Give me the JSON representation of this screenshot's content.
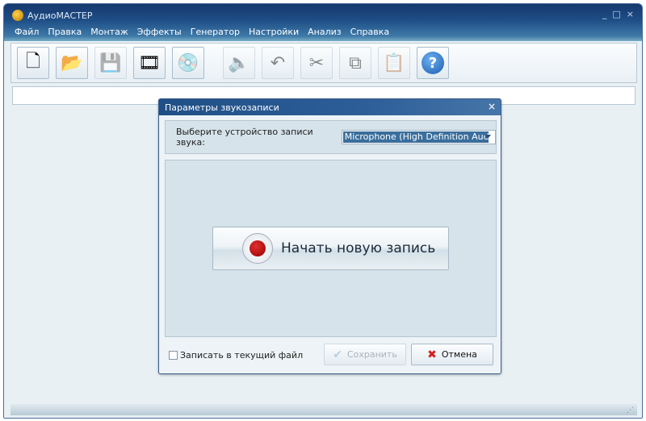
{
  "window": {
    "title": "АудиоМАСТЕР",
    "controls": [
      "_",
      "□",
      "×"
    ]
  },
  "menu": [
    "Файл",
    "Правка",
    "Монтаж",
    "Эффекты",
    "Генератор",
    "Настройки",
    "Анализ",
    "Справка"
  ],
  "toolbar": [
    {
      "icon": "new-file-icon",
      "glyph": "🗋",
      "enabled": true
    },
    {
      "icon": "open-folder-icon",
      "glyph": "📂",
      "enabled": true
    },
    {
      "icon": "save-icon",
      "glyph": "💾",
      "enabled": false
    },
    {
      "icon": "video-add-icon",
      "glyph": "🎞",
      "enabled": true
    },
    {
      "icon": "cd-music-icon",
      "glyph": "💿",
      "enabled": true
    },
    {
      "icon": "speaker-volume-icon",
      "glyph": "🔈",
      "enabled": false
    },
    {
      "icon": "undo-icon",
      "glyph": "↶",
      "enabled": false
    },
    {
      "icon": "cut-icon",
      "glyph": "✂",
      "enabled": false
    },
    {
      "icon": "copy-icon",
      "glyph": "⧉",
      "enabled": false
    },
    {
      "icon": "paste-icon",
      "glyph": "📋",
      "enabled": false
    },
    {
      "icon": "help-icon",
      "glyph": "?",
      "enabled": true
    }
  ],
  "dialog": {
    "title": "Параметры звукозаписи",
    "close": "×",
    "device_label": "Выберите устройство записи звука:",
    "device_value": "Microphone (High Definition Aud",
    "record_label": "Начать новую запись",
    "checkbox_label": "Записать в текущий файл",
    "checkbox_checked": false,
    "save_label": "Сохранить",
    "cancel_label": "Отмена"
  }
}
